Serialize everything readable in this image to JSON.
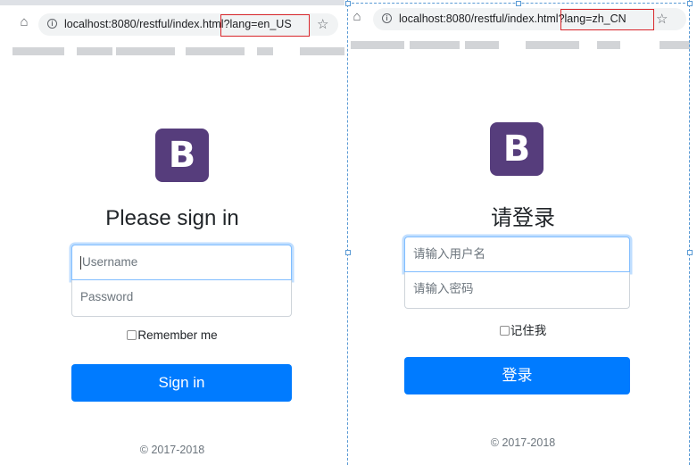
{
  "en": {
    "url": "localhost:8080/restful/index.html?lang=en_US",
    "heading": "Please sign in",
    "username_placeholder": "Username",
    "password_placeholder": "Password",
    "remember_label": "Remember me",
    "signin_button": "Sign in",
    "footer": "© 2017-2018",
    "logo_letter": "B"
  },
  "zh": {
    "url": "localhost:8080/restful/index.html?lang=zh_CN",
    "heading": "请登录",
    "username_placeholder": "请输入用户名",
    "password_placeholder": "请输入密码",
    "remember_label": "记住我",
    "signin_button": "登录",
    "footer": "© 2017-2018",
    "logo_letter": "B"
  },
  "browser": {
    "home_icon": "home-icon",
    "star_icon": "star-icon",
    "info_icon": "info-icon",
    "home_glyph": "⌂",
    "star_glyph": "☆",
    "info_glyph": "i"
  },
  "colors": {
    "brand_purple": "#563d7c",
    "primary_blue": "#007bff",
    "highlight_red": "#d9262b",
    "selection_blue": "#5b9bd5"
  }
}
